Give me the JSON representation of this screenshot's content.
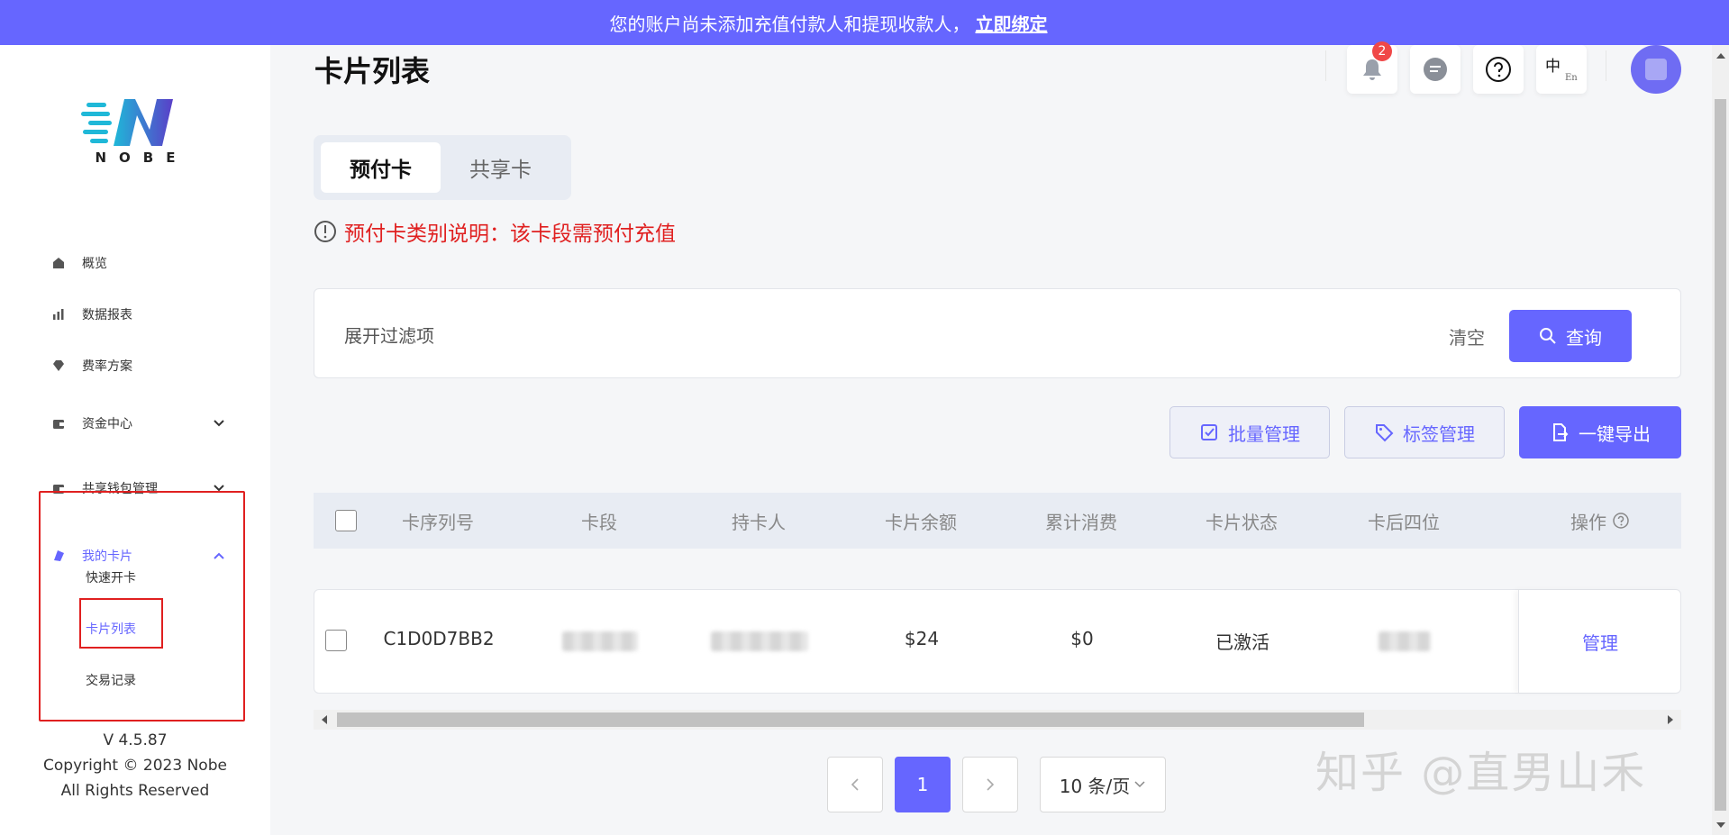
{
  "banner": {
    "text": "您的账户尚未添加充值付款人和提现收款人，",
    "link": "立即绑定"
  },
  "sidebar": {
    "logo_word": "NOBE",
    "items": [
      {
        "label": "概览",
        "icon": "home-icon"
      },
      {
        "label": "数据报表",
        "icon": "bar-chart-icon"
      },
      {
        "label": "费率方案",
        "icon": "diamond-icon"
      },
      {
        "label": "资金中心",
        "icon": "wallet-icon"
      },
      {
        "label": "共享钱包管理",
        "icon": "wallet-icon"
      },
      {
        "label": "我的卡片",
        "icon": "card-icon"
      }
    ],
    "sub_items": [
      {
        "label": "快速开卡"
      },
      {
        "label": "卡片列表"
      },
      {
        "label": "交易记录"
      }
    ],
    "version": "V 4.5.87",
    "copyright": "Copyright © 2023 Nobe",
    "rights": "All Rights Reserved"
  },
  "header": {
    "title": "卡片列表",
    "notification_count": "2",
    "lang_primary": "中",
    "lang_secondary": "En"
  },
  "tabs": [
    {
      "label": "预付卡",
      "active": true
    },
    {
      "label": "共享卡",
      "active": false
    }
  ],
  "notice": "预付卡类别说明：该卡段需预付充值",
  "filter": {
    "expand_label": "展开过滤项",
    "clear_label": "清空",
    "query_label": "查询"
  },
  "actions": {
    "batch": "批量管理",
    "tag": "标签管理",
    "export": "一键导出"
  },
  "table": {
    "columns": [
      "卡序列号",
      "卡段",
      "持卡人",
      "卡片余额",
      "累计消费",
      "卡片状态",
      "卡后四位",
      "操作"
    ],
    "rows": [
      {
        "serial": "C1D0D7BB2",
        "segment": "",
        "holder": "",
        "balance": "$24",
        "spent": "$0",
        "status": "已激活",
        "last4": "",
        "action": "管理"
      }
    ]
  },
  "pagination": {
    "current": "1",
    "page_size": "10 条/页"
  },
  "watermark": "知乎 @直男山禾",
  "colors": {
    "accent": "#6666ff",
    "danger": "#e02020"
  }
}
